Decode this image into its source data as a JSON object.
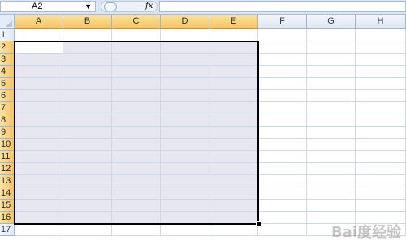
{
  "formula_bar": {
    "name_box": "A2",
    "dropdown_icon": "chevron-down-icon",
    "fx_label": "fx",
    "formula_value": ""
  },
  "columns": [
    "A",
    "B",
    "C",
    "D",
    "E",
    "F",
    "G",
    "H"
  ],
  "rows": [
    "1",
    "2",
    "3",
    "4",
    "5",
    "6",
    "7",
    "8",
    "9",
    "10",
    "11",
    "12",
    "13",
    "14",
    "15",
    "16",
    "17"
  ],
  "selection": {
    "range_start": "A2",
    "range_end": "E16",
    "active_cell": "A2",
    "selected_columns": [
      "A",
      "B",
      "C",
      "D",
      "E"
    ],
    "selected_rows": [
      "2",
      "3",
      "4",
      "5",
      "6",
      "7",
      "8",
      "9",
      "10",
      "11",
      "12",
      "13",
      "14",
      "15",
      "16"
    ]
  },
  "colors": {
    "header_selected": "#f6c35f",
    "selection_fill": "#e6e7f1",
    "gridline": "#d0d7e5"
  },
  "watermark": "Bai度经验"
}
